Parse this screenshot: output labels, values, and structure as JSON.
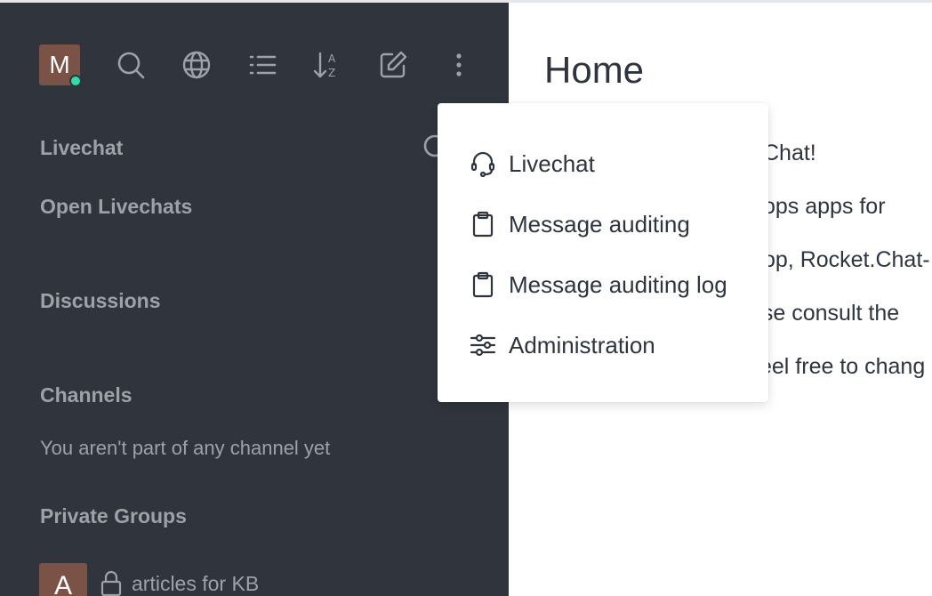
{
  "user": {
    "initial": "M",
    "status_color": "#2de0a5",
    "avatar_color": "#7a5346"
  },
  "toolbar": {
    "icons": [
      "search-icon",
      "globe-icon",
      "list-icon",
      "sort-az-icon",
      "edit-icon",
      "kebab-menu-icon"
    ]
  },
  "sidebar": {
    "sections": {
      "livechat": "Livechat",
      "open_livechats": "Open Livechats",
      "discussions": "Discussions",
      "channels": "Channels",
      "private_groups": "Private Groups"
    },
    "channels_empty": "You aren't part of any channel yet",
    "private_groups": [
      {
        "initial": "A",
        "name": "articles for KB"
      }
    ]
  },
  "main": {
    "title": "Home",
    "lines": [
      "Chat!",
      "sktops apps for",
      "op, Rocket.Chat-",
      "ase consult the",
      "eel free to chang"
    ]
  },
  "menu": {
    "items": [
      {
        "label": "Livechat",
        "icon": "headset-icon"
      },
      {
        "label": "Message auditing",
        "icon": "clipboard-icon"
      },
      {
        "label": "Message auditing log",
        "icon": "clipboard-icon"
      },
      {
        "label": "Administration",
        "icon": "sliders-icon"
      }
    ]
  },
  "colors": {
    "sidebar_bg": "#2f343d",
    "sidebar_text": "#9ea2a8",
    "main_text": "#2f343d"
  }
}
